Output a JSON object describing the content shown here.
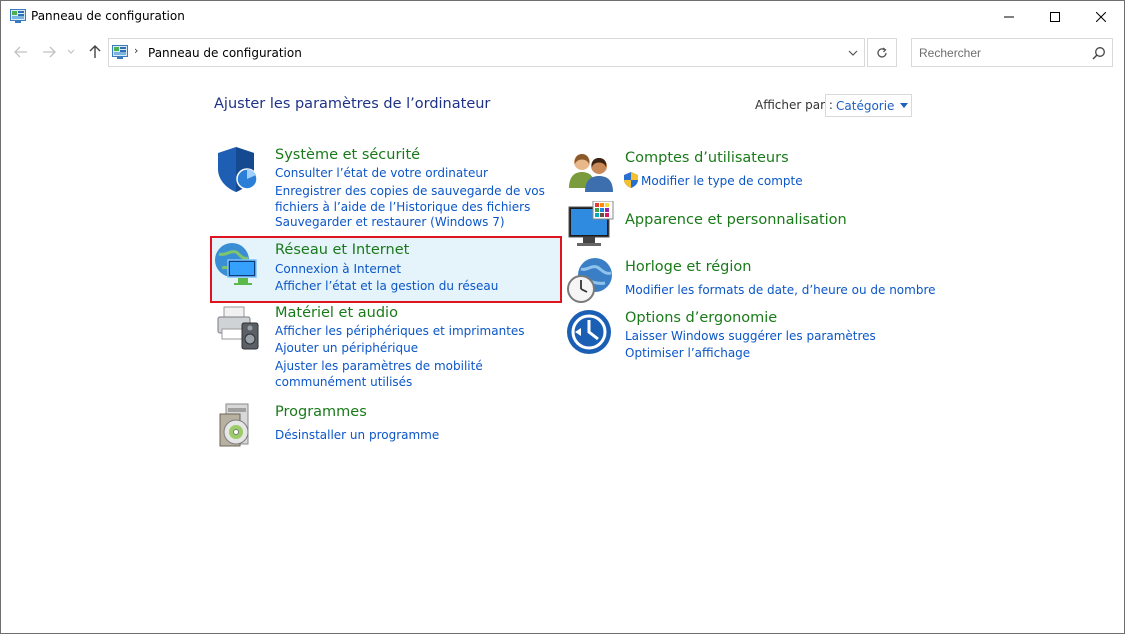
{
  "window": {
    "title": "Panneau de configuration",
    "icon": "control-panel-icon"
  },
  "nav": {
    "breadcrumb": "Panneau de configuration",
    "search_placeholder": "Rechercher"
  },
  "header": {
    "title": "Ajuster les paramètres de l’ordinateur",
    "view_by_label": "Afficher par :",
    "view_by_value": "Catégorie"
  },
  "categories_left": [
    {
      "icon": "shield-security-icon",
      "title": "Système et sécurité",
      "links": [
        "Consulter l’état de votre ordinateur",
        "Enregistrer des copies de sauvegarde de vos fichiers à l’aide de l’Historique des fichiers",
        "Sauvegarder et restaurer (Windows 7)"
      ]
    },
    {
      "icon": "network-globe-icon",
      "title": "Réseau et Internet",
      "links": [
        "Connexion à Internet",
        "Afficher l’état et la gestion du réseau"
      ]
    },
    {
      "icon": "printer-speaker-icon",
      "title": "Matériel et audio",
      "links": [
        "Afficher les périphériques et imprimantes",
        "Ajouter un périphérique",
        "Ajuster les paramètres de mobilité communément utilisés"
      ]
    },
    {
      "icon": "programs-disc-icon",
      "title": "Programmes",
      "links": [
        "Désinstaller un programme"
      ]
    }
  ],
  "categories_right": [
    {
      "icon": "user-accounts-icon",
      "title": "Comptes d’utilisateurs",
      "links": [
        "Modifier le type de compte"
      ]
    },
    {
      "icon": "appearance-monitor-icon",
      "title": "Apparence et personnalisation",
      "links": []
    },
    {
      "icon": "clock-globe-icon",
      "title": "Horloge et région",
      "links": [
        "Modifier les formats de date, d’heure ou de nombre"
      ]
    },
    {
      "icon": "ease-of-access-icon",
      "title": "Options d’ergonomie",
      "links": [
        "Laisser Windows suggérer les paramètres",
        "Optimiser l’affichage"
      ]
    }
  ],
  "colors": {
    "heading_green": "#1a7a1a",
    "link_blue": "#0b56c8",
    "title_blue": "#1e3287",
    "highlight_border": "#e0141e",
    "highlight_fill": "#e5f3fb"
  }
}
